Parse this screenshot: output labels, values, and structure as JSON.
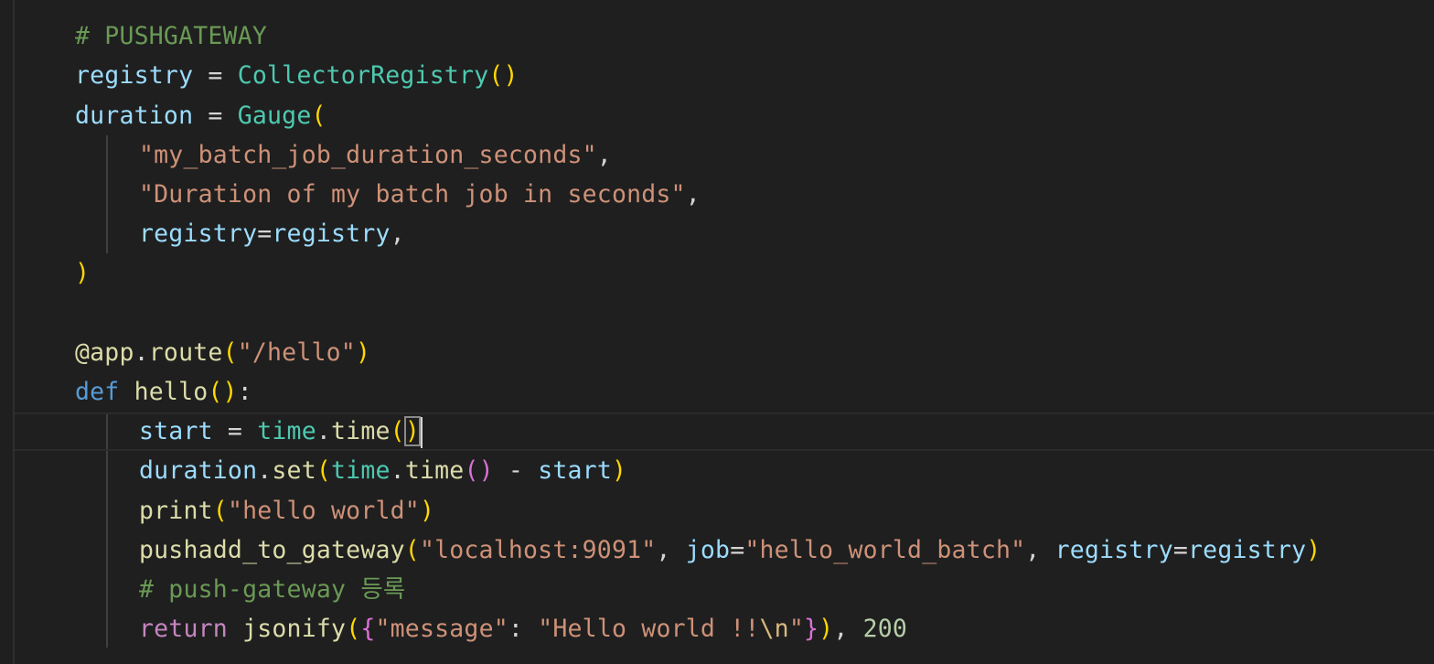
{
  "editor": {
    "lines": [
      {
        "id": "l1",
        "tokens": [
          {
            "t": "# PUSHGATEWAY",
            "c": "comment"
          }
        ]
      },
      {
        "id": "l2",
        "tokens": [
          {
            "t": "registry",
            "c": "var"
          },
          {
            "t": " = ",
            "c": "op"
          },
          {
            "t": "CollectorRegistry",
            "c": "class"
          },
          {
            "t": "()",
            "c": "p1"
          }
        ]
      },
      {
        "id": "l3",
        "tokens": [
          {
            "t": "duration",
            "c": "var"
          },
          {
            "t": " = ",
            "c": "op"
          },
          {
            "t": "Gauge",
            "c": "class"
          },
          {
            "t": "(",
            "c": "p1"
          }
        ]
      },
      {
        "id": "l4",
        "tokens": [
          {
            "t": "\"my_batch_job_duration_seconds\"",
            "c": "str"
          },
          {
            "t": ",",
            "c": "op"
          }
        ]
      },
      {
        "id": "l5",
        "tokens": [
          {
            "t": "\"Duration of my batch job in seconds\"",
            "c": "str"
          },
          {
            "t": ",",
            "c": "op"
          }
        ]
      },
      {
        "id": "l6",
        "tokens": [
          {
            "t": "registry",
            "c": "var"
          },
          {
            "t": "=",
            "c": "op"
          },
          {
            "t": "registry",
            "c": "var"
          },
          {
            "t": ",",
            "c": "op"
          }
        ]
      },
      {
        "id": "l7",
        "tokens": [
          {
            "t": ")",
            "c": "p1"
          }
        ]
      },
      {
        "id": "l8",
        "tokens": [
          {
            "t": "@app",
            "c": "func"
          },
          {
            "t": ".",
            "c": "op"
          },
          {
            "t": "route",
            "c": "func"
          },
          {
            "t": "(",
            "c": "p1"
          },
          {
            "t": "\"/hello\"",
            "c": "str"
          },
          {
            "t": ")",
            "c": "p1"
          }
        ]
      },
      {
        "id": "l9",
        "tokens": [
          {
            "t": "def",
            "c": "kw"
          },
          {
            "t": " ",
            "c": "op"
          },
          {
            "t": "hello",
            "c": "func"
          },
          {
            "t": "()",
            "c": "p1"
          },
          {
            "t": ":",
            "c": "op"
          }
        ]
      },
      {
        "id": "l10",
        "tokens": [
          {
            "t": "start",
            "c": "var"
          },
          {
            "t": " = ",
            "c": "op"
          },
          {
            "t": "time",
            "c": "class"
          },
          {
            "t": ".",
            "c": "op"
          },
          {
            "t": "time",
            "c": "func"
          },
          {
            "t": "(",
            "c": "p1"
          },
          {
            "t": ")",
            "c": "p1",
            "box": true
          }
        ]
      },
      {
        "id": "l11",
        "tokens": [
          {
            "t": "duration",
            "c": "var"
          },
          {
            "t": ".",
            "c": "op"
          },
          {
            "t": "set",
            "c": "func"
          },
          {
            "t": "(",
            "c": "p1"
          },
          {
            "t": "time",
            "c": "class"
          },
          {
            "t": ".",
            "c": "op"
          },
          {
            "t": "time",
            "c": "func"
          },
          {
            "t": "()",
            "c": "p2"
          },
          {
            "t": " - ",
            "c": "op"
          },
          {
            "t": "start",
            "c": "var"
          },
          {
            "t": ")",
            "c": "p1"
          }
        ]
      },
      {
        "id": "l12",
        "tokens": [
          {
            "t": "print",
            "c": "func"
          },
          {
            "t": "(",
            "c": "p1"
          },
          {
            "t": "\"hello world\"",
            "c": "str"
          },
          {
            "t": ")",
            "c": "p1"
          }
        ]
      },
      {
        "id": "l13",
        "tokens": [
          {
            "t": "pushadd_to_gateway",
            "c": "func"
          },
          {
            "t": "(",
            "c": "p1"
          },
          {
            "t": "\"localhost:9091\"",
            "c": "str"
          },
          {
            "t": ", ",
            "c": "op"
          },
          {
            "t": "job",
            "c": "var"
          },
          {
            "t": "=",
            "c": "op"
          },
          {
            "t": "\"hello_world_batch\"",
            "c": "str"
          },
          {
            "t": ", ",
            "c": "op"
          },
          {
            "t": "registry",
            "c": "var"
          },
          {
            "t": "=",
            "c": "op"
          },
          {
            "t": "registry",
            "c": "var"
          },
          {
            "t": ")",
            "c": "p1"
          }
        ]
      },
      {
        "id": "l14",
        "tokens": [
          {
            "t": "# push-gateway 등록",
            "c": "comment"
          }
        ]
      },
      {
        "id": "l15",
        "tokens": [
          {
            "t": "return",
            "c": "ret"
          },
          {
            "t": " ",
            "c": "op"
          },
          {
            "t": "jsonify",
            "c": "func"
          },
          {
            "t": "(",
            "c": "p1"
          },
          {
            "t": "{",
            "c": "p2"
          },
          {
            "t": "\"message\"",
            "c": "str"
          },
          {
            "t": ": ",
            "c": "op"
          },
          {
            "t": "\"Hello world !!",
            "c": "str"
          },
          {
            "t": "\\n",
            "c": "esc"
          },
          {
            "t": "\"",
            "c": "str"
          },
          {
            "t": "}",
            "c": "p2"
          },
          {
            "t": ")",
            "c": "p1"
          },
          {
            "t": ", ",
            "c": "op"
          },
          {
            "t": "200",
            "c": "num"
          }
        ]
      }
    ],
    "colors": {
      "background": "#1f1f1f",
      "comment": "#6a9955",
      "variable": "#9cdcfe",
      "class": "#4ec9b0",
      "function": "#dcdcaa",
      "string": "#ce9178",
      "keyword": "#569cd6",
      "control": "#c586c0",
      "number": "#b5cea8",
      "bracket1": "#ffd700",
      "bracket2": "#da70d6"
    }
  }
}
